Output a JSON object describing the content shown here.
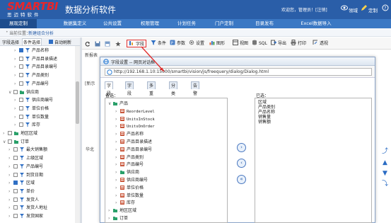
{
  "app": {
    "logo_main": "SMARTBI",
    "logo_sub": "思迈特软件",
    "title": "数据分析软件",
    "user": "欢迎您，管理员！[注销]",
    "view_label": "领域",
    "customize_label": "定制",
    "help_label": "帮助"
  },
  "nav": [
    "展现定制",
    "数据集定义",
    "公共设置",
    "权限管理",
    "计划任务",
    "门户定制",
    "目录发布",
    "Excel数据导入"
  ],
  "breadcrumb": {
    "prefix": "当前位置：",
    "current": "新建组合分析"
  },
  "left_panel": {
    "tab1": "字段选择",
    "tab2": "条件选择",
    "auto_refresh": "自动刷新",
    "tree": [
      {
        "indent": 2,
        "exp": "›",
        "checked": true,
        "icon": "field",
        "label": "产品名称"
      },
      {
        "indent": 2,
        "exp": "›",
        "checked": false,
        "icon": "field",
        "label": "产品目录描述"
      },
      {
        "indent": 2,
        "exp": "›",
        "checked": false,
        "icon": "field",
        "label": "产品目录编号"
      },
      {
        "indent": 2,
        "exp": "›",
        "checked": false,
        "icon": "field",
        "label": "产品类别"
      },
      {
        "indent": 2,
        "exp": "›",
        "checked": false,
        "icon": "field",
        "label": "产品编号"
      },
      {
        "indent": 1,
        "exp": "∨",
        "checked": false,
        "icon": "folder",
        "label": "供应商"
      },
      {
        "indent": 2,
        "exp": "›",
        "checked": false,
        "icon": "field",
        "label": "供应商编号"
      },
      {
        "indent": 2,
        "exp": "›",
        "checked": false,
        "icon": "field",
        "label": "单位价格"
      },
      {
        "indent": 2,
        "exp": "›",
        "checked": false,
        "icon": "field",
        "label": "单位数量"
      },
      {
        "indent": 2,
        "exp": "›",
        "checked": false,
        "icon": "field",
        "label": "库存"
      },
      {
        "indent": 0,
        "exp": "›",
        "checked": false,
        "icon": "folder",
        "label": "地区区域"
      },
      {
        "indent": 0,
        "exp": "∨",
        "checked": false,
        "icon": "folder",
        "label": "订单"
      },
      {
        "indent": 1,
        "exp": "›",
        "checked": false,
        "icon": "field",
        "label": "最大销售额"
      },
      {
        "indent": 1,
        "exp": "›",
        "checked": false,
        "icon": "field",
        "label": "上级区域"
      },
      {
        "indent": 1,
        "exp": "›",
        "checked": false,
        "icon": "field",
        "label": "产品编号"
      },
      {
        "indent": 1,
        "exp": "›",
        "checked": false,
        "icon": "field",
        "label": "到货日期"
      },
      {
        "indent": 1,
        "exp": "›",
        "checked": true,
        "icon": "field",
        "label": "区域"
      },
      {
        "indent": 1,
        "exp": "›",
        "checked": false,
        "icon": "field",
        "label": "单价"
      },
      {
        "indent": 1,
        "exp": "›",
        "checked": false,
        "icon": "field",
        "label": "发货人"
      },
      {
        "indent": 1,
        "exp": "›",
        "checked": false,
        "icon": "field",
        "label": "发货人地址"
      },
      {
        "indent": 1,
        "exp": "›",
        "checked": false,
        "icon": "field",
        "label": "发货国家"
      }
    ]
  },
  "toolbar": {
    "field": "字段",
    "condition": "条件",
    "param": "参数",
    "settings": "设置",
    "chart": "图形",
    "view": "视图",
    "sql": "SQL",
    "export": "导出",
    "print": "打印",
    "more": "透视"
  },
  "background": {
    "label1": "新报表",
    "label2": "[新示",
    "label3": "华北"
  },
  "dialog": {
    "title": "字段设置 -- 网页对话框",
    "url": "http://192.168.1.10:15000/smartbi/vision/js/freequery/dialog/Dialog.html",
    "tabs": [
      "字段选择",
      "字段设置",
      "多重表头",
      "分类汇总",
      "告警设置"
    ],
    "available_label": "备选：",
    "selected_label": "已选：",
    "source_tree": [
      {
        "indent": 0,
        "exp": "∨",
        "icon": "folder",
        "label": "产品",
        "mono": false
      },
      {
        "indent": 1,
        "exp": "›",
        "icon": "field",
        "label": "ReorderLevel",
        "mono": true
      },
      {
        "indent": 1,
        "exp": "›",
        "icon": "field",
        "label": "UnitsInStock",
        "mono": true
      },
      {
        "indent": 1,
        "exp": "›",
        "icon": "field",
        "label": "UnitsOnOrder",
        "mono": true
      },
      {
        "indent": 1,
        "exp": "›",
        "icon": "field",
        "label": "产品名称",
        "mono": false
      },
      {
        "indent": 1,
        "exp": "›",
        "icon": "field",
        "label": "产品目录描述",
        "mono": false
      },
      {
        "indent": 1,
        "exp": "›",
        "icon": "field",
        "label": "产品目录编号",
        "mono": false
      },
      {
        "indent": 1,
        "exp": "›",
        "icon": "field",
        "label": "产品类别",
        "mono": false
      },
      {
        "indent": 1,
        "exp": "›",
        "icon": "field",
        "label": "产品编号",
        "mono": false
      },
      {
        "indent": 1,
        "exp": "›",
        "icon": "folder",
        "label": "供应商",
        "mono": false
      },
      {
        "indent": 1,
        "exp": "›",
        "icon": "field",
        "label": "供应商编号",
        "mono": false
      },
      {
        "indent": 1,
        "exp": "›",
        "icon": "field",
        "label": "单位价格",
        "mono": false
      },
      {
        "indent": 1,
        "exp": "›",
        "icon": "field",
        "label": "单位数量",
        "mono": false
      },
      {
        "indent": 1,
        "exp": "›",
        "icon": "field",
        "label": "库存",
        "mono": false
      },
      {
        "indent": 0,
        "exp": "›",
        "icon": "folder",
        "label": "地区区域",
        "mono": false
      },
      {
        "indent": 0,
        "exp": "›",
        "icon": "folder",
        "label": "订单",
        "mono": false
      }
    ],
    "selected": [
      "区域",
      "产品类别",
      "产品名称",
      "销售量",
      "销售额"
    ],
    "buttons": {
      "add": "›",
      "remove": "‹",
      "remove_all": "«"
    }
  },
  "colors": {
    "topbar": "#2a5ea8",
    "nav": "#3b78c4",
    "logo_red": "#e8262b",
    "highlight": "#e02b2b"
  }
}
